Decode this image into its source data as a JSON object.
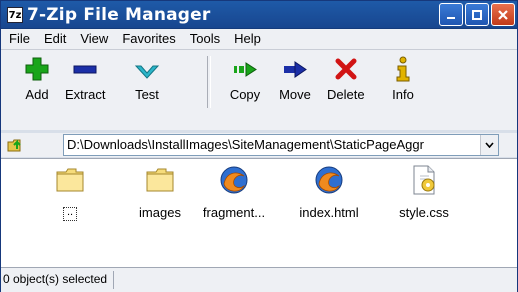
{
  "window": {
    "title": "7-Zip File Manager",
    "icon_label": "7z"
  },
  "menu": {
    "items": [
      {
        "label": "File"
      },
      {
        "label": "Edit"
      },
      {
        "label": "View"
      },
      {
        "label": "Favorites"
      },
      {
        "label": "Tools"
      },
      {
        "label": "Help"
      }
    ]
  },
  "toolbar": {
    "add_label": "Add",
    "extract_label": "Extract",
    "test_label": "Test",
    "copy_label": "Copy",
    "move_label": "Move",
    "delete_label": "Delete",
    "info_label": "Info"
  },
  "address": {
    "path": "D:\\Downloads\\InstallImages\\SiteManagement\\StaticPageAggr"
  },
  "files": [
    {
      "name": "..",
      "icon": "folder-icon"
    },
    {
      "name": "images",
      "icon": "folder-icon"
    },
    {
      "name": "fragment...",
      "icon": "firefox-html-icon"
    },
    {
      "name": "index.html",
      "icon": "firefox-html-icon"
    },
    {
      "name": "style.css",
      "icon": "css-file-icon"
    }
  ],
  "status": {
    "selection_text": "0 object(s) selected"
  },
  "colors": {
    "titlebar": "#1e5aa8",
    "add_green": "#1aa51a",
    "extract_blue": "#1b2fa7",
    "test_cyan": "#2bb5c9",
    "delete_red": "#d11414",
    "info_yellow": "#e1b300",
    "close_red": "#d44a25"
  }
}
